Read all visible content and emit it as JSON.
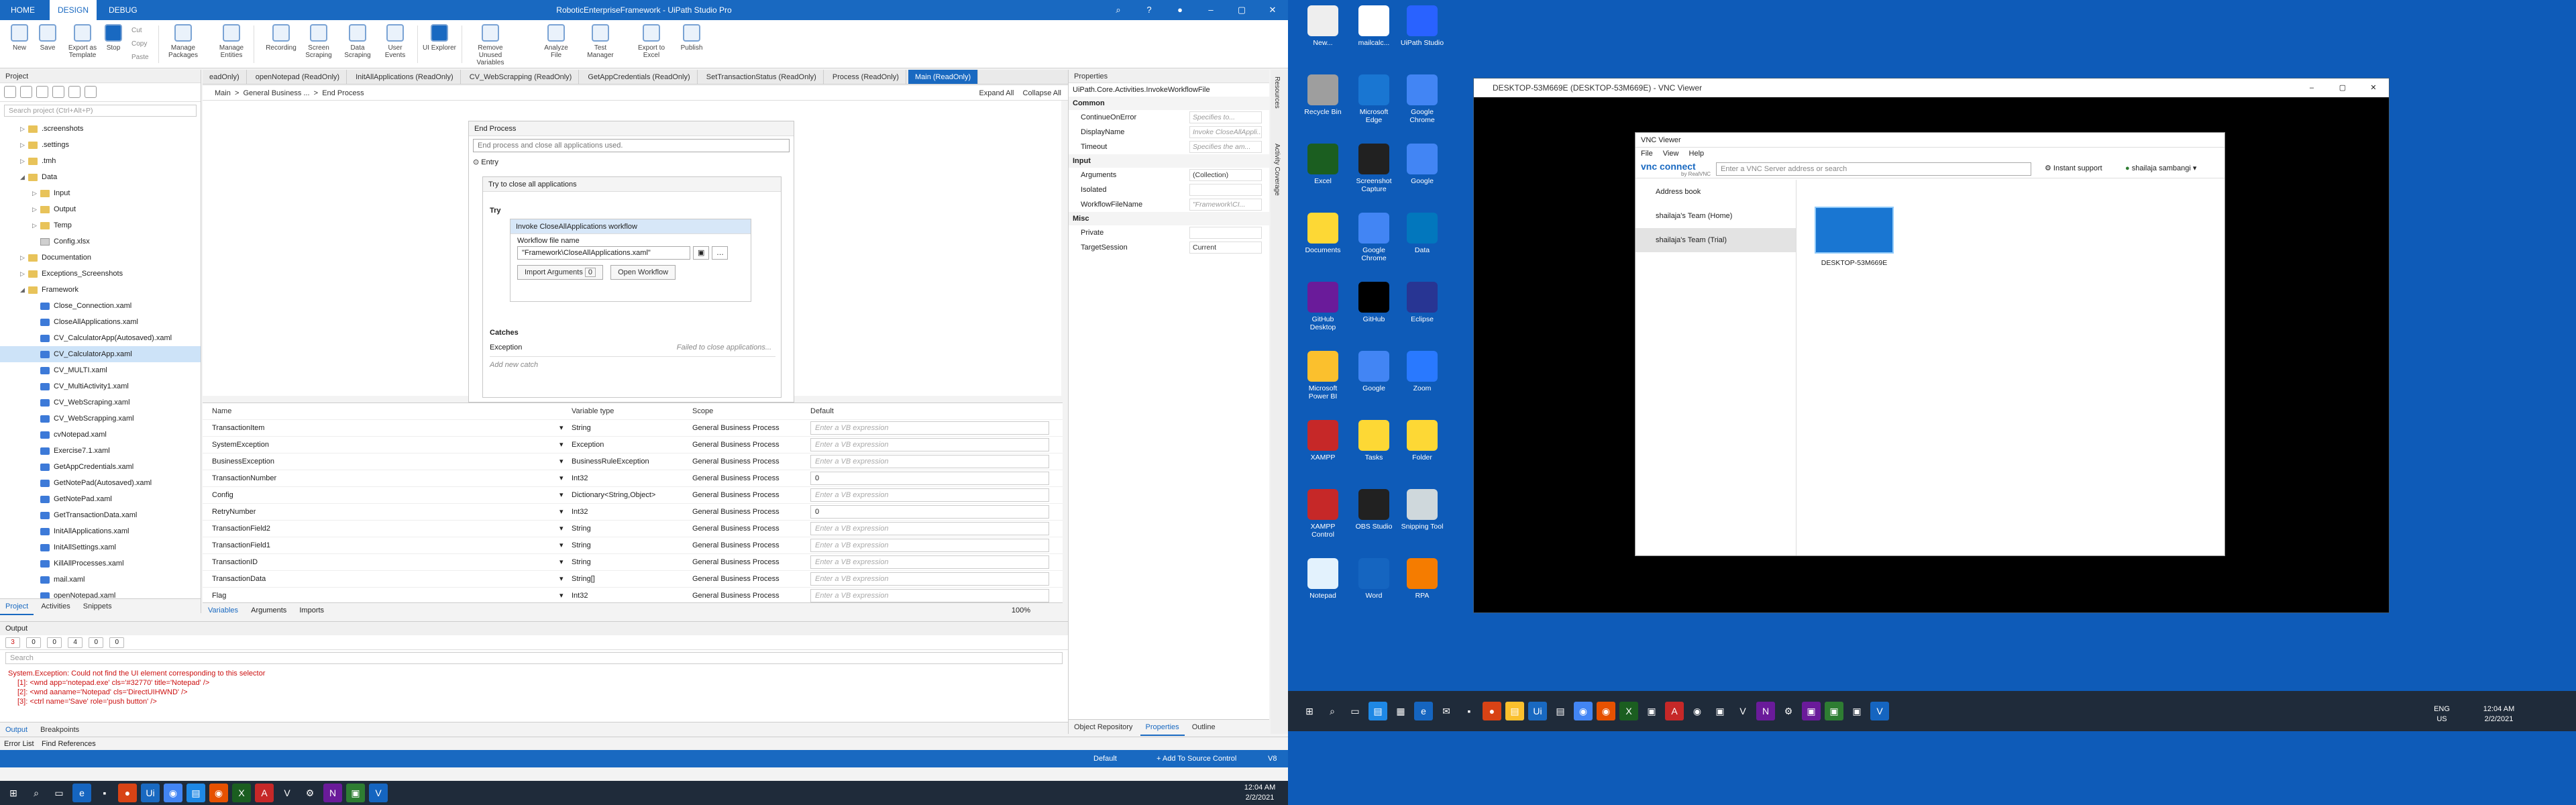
{
  "uipath": {
    "window_title": "RoboticEnterpriseFramework - UiPath Studio Pro",
    "ribbon_tabs": [
      "HOME",
      "DESIGN",
      "DEBUG"
    ],
    "ribbon_buttons": [
      {
        "label": "New"
      },
      {
        "label": "Save"
      },
      {
        "label": "Export as Template"
      },
      {
        "label": "Stop"
      },
      {
        "label": "Manage Packages"
      },
      {
        "label": "Manage Entities"
      },
      {
        "label": "Recording"
      },
      {
        "label": "Screen Scraping"
      },
      {
        "label": "Data Scraping"
      },
      {
        "label": "User Events"
      },
      {
        "label": "UI Explorer"
      },
      {
        "label": "Remove Unused Variables"
      },
      {
        "label": "Analyze File"
      },
      {
        "label": "Test Manager"
      },
      {
        "label": "Export to Excel"
      },
      {
        "label": "Publish"
      }
    ],
    "ribbon_small": [
      "Cut",
      "Copy",
      "Paste"
    ],
    "project_panel": {
      "title": "Project",
      "search_placeholder": "Search project (Ctrl+Alt+P)",
      "tree": [
        {
          "label": ".screenshots",
          "type": "folder",
          "level": 1,
          "arrow": "▷"
        },
        {
          "label": ".settings",
          "type": "folder",
          "level": 1,
          "arrow": "▷"
        },
        {
          "label": ".tmh",
          "type": "folder",
          "level": 1,
          "arrow": "▷"
        },
        {
          "label": "Data",
          "type": "folder",
          "level": 1,
          "arrow": "◢"
        },
        {
          "label": "Input",
          "type": "folder",
          "level": 2,
          "arrow": "▷"
        },
        {
          "label": "Output",
          "type": "folder",
          "level": 2,
          "arrow": "▷"
        },
        {
          "label": "Temp",
          "type": "folder",
          "level": 2,
          "arrow": "▷"
        },
        {
          "label": "Config.xlsx",
          "type": "file",
          "level": 2,
          "arrow": ""
        },
        {
          "label": "Documentation",
          "type": "folder",
          "level": 1,
          "arrow": "▷"
        },
        {
          "label": "Exceptions_Screenshots",
          "type": "folder",
          "level": 1,
          "arrow": "▷"
        },
        {
          "label": "Framework",
          "type": "folder",
          "level": 1,
          "arrow": "◢"
        },
        {
          "label": "Close_Connection.xaml",
          "type": "xaml",
          "level": 2,
          "arrow": ""
        },
        {
          "label": "CloseAllApplications.xaml",
          "type": "xaml",
          "level": 2,
          "arrow": ""
        },
        {
          "label": "CV_CalculatorApp(Autosaved).xaml",
          "type": "xaml",
          "level": 2,
          "arrow": ""
        },
        {
          "label": "CV_CalculatorApp.xaml",
          "type": "xaml",
          "level": 2,
          "arrow": "",
          "selected": true
        },
        {
          "label": "CV_MULTI.xaml",
          "type": "xaml",
          "level": 2,
          "arrow": ""
        },
        {
          "label": "CV_MultiActivity1.xaml",
          "type": "xaml",
          "level": 2,
          "arrow": ""
        },
        {
          "label": "CV_WebScraping.xaml",
          "type": "xaml",
          "level": 2,
          "arrow": ""
        },
        {
          "label": "CV_WebScrapping.xaml",
          "type": "xaml",
          "level": 2,
          "arrow": ""
        },
        {
          "label": "cvNotepad.xaml",
          "type": "xaml",
          "level": 2,
          "arrow": ""
        },
        {
          "label": "Exercise7.1.xaml",
          "type": "xaml",
          "level": 2,
          "arrow": ""
        },
        {
          "label": "GetAppCredentials.xaml",
          "type": "xaml",
          "level": 2,
          "arrow": ""
        },
        {
          "label": "GetNotePad(Autosaved).xaml",
          "type": "xaml",
          "level": 2,
          "arrow": ""
        },
        {
          "label": "GetNotePad.xaml",
          "type": "xaml",
          "level": 2,
          "arrow": ""
        },
        {
          "label": "GetTransactionData.xaml",
          "type": "xaml",
          "level": 2,
          "arrow": ""
        },
        {
          "label": "InitAllApplications.xaml",
          "type": "xaml",
          "level": 2,
          "arrow": ""
        },
        {
          "label": "InitAllSettings.xaml",
          "type": "xaml",
          "level": 2,
          "arrow": ""
        },
        {
          "label": "KillAllProcesses.xaml",
          "type": "xaml",
          "level": 2,
          "arrow": ""
        },
        {
          "label": "mail.xaml",
          "type": "xaml",
          "level": 2,
          "arrow": ""
        },
        {
          "label": "openNotepad.xaml",
          "type": "xaml",
          "level": 2,
          "arrow": ""
        }
      ],
      "bottom_tabs": [
        "Project",
        "Activities",
        "Snippets"
      ]
    },
    "doc_tabs": [
      "eadOnly)",
      "openNotepad (ReadOnly)",
      "InitAllApplications (ReadOnly)",
      "CV_WebScrapping (ReadOnly)",
      "GetAppCredentials (ReadOnly)",
      "SetTransactionStatus (ReadOnly)",
      "Process (ReadOnly)",
      "Main (ReadOnly)"
    ],
    "breadcrumb": {
      "items": [
        "Main",
        "General Business ...",
        "End Process"
      ],
      "expand_all": "Expand All",
      "collapse_all": "Collapse All"
    },
    "designer": {
      "end_process_title": "End Process",
      "end_process_desc": "End process and close all applications used.",
      "entry_label": "Entry",
      "try_close_title": "Try to close all applications",
      "try_label": "Try",
      "invoke_title": "Invoke CloseAllApplications workflow",
      "workflow_file_label": "Workflow file name",
      "workflow_file_value": "\"Framework\\CloseAllApplications.xaml\"",
      "import_args": "Import Arguments",
      "import_count": "0",
      "open_workflow": "Open Workflow",
      "catches_label": "Catches",
      "exception_label": "Exception",
      "exception_value": "Failed to close applications...",
      "add_catch": "Add new catch"
    },
    "variables": {
      "headers": [
        "Name",
        "Variable type",
        "Scope",
        "Default"
      ],
      "rows": [
        {
          "name": "TransactionItem",
          "type": "String",
          "scope": "General Business Process",
          "default": "Enter a VB expression"
        },
        {
          "name": "SystemException",
          "type": "Exception",
          "scope": "General Business Process",
          "default": "Enter a VB expression"
        },
        {
          "name": "BusinessException",
          "type": "BusinessRuleException",
          "scope": "General Business Process",
          "default": "Enter a VB expression"
        },
        {
          "name": "TransactionNumber",
          "type": "Int32",
          "scope": "General Business Process",
          "default": "0"
        },
        {
          "name": "Config",
          "type": "Dictionary<String,Object>",
          "scope": "General Business Process",
          "default": "Enter a VB expression"
        },
        {
          "name": "RetryNumber",
          "type": "Int32",
          "scope": "General Business Process",
          "default": "0"
        },
        {
          "name": "TransactionField2",
          "type": "String",
          "scope": "General Business Process",
          "default": "Enter a VB expression"
        },
        {
          "name": "TransactionField1",
          "type": "String",
          "scope": "General Business Process",
          "default": "Enter a VB expression"
        },
        {
          "name": "TransactionID",
          "type": "String",
          "scope": "General Business Process",
          "default": "Enter a VB expression"
        },
        {
          "name": "TransactionData",
          "type": "String[]",
          "scope": "General Business Process",
          "default": "Enter a VB expression"
        },
        {
          "name": "Flag",
          "type": "Int32",
          "scope": "General Business Process",
          "default": "Enter a VB expression"
        }
      ],
      "bottom_tabs": [
        "Variables",
        "Arguments",
        "Imports"
      ],
      "zoom": "100%"
    },
    "properties": {
      "title": "Properties",
      "activity_name": "UiPath.Core.Activities.InvokeWorkflowFile",
      "sections": [
        {
          "name": "Common",
          "rows": [
            {
              "label": "ContinueOnError",
              "value": "Specifies to..."
            },
            {
              "label": "DisplayName",
              "value": "Invoke CloseAllAppli..."
            },
            {
              "label": "Timeout",
              "value": "Specifies the am..."
            }
          ]
        },
        {
          "name": "Input",
          "rows": [
            {
              "label": "Arguments",
              "value": "(Collection)"
            },
            {
              "label": "Isolated",
              "value": ""
            },
            {
              "label": "WorkflowFileName",
              "value": "\"Framework\\CI..."
            }
          ]
        },
        {
          "name": "Misc",
          "rows": [
            {
              "label": "Private",
              "value": ""
            },
            {
              "label": "TargetSession",
              "value": "Current"
            }
          ]
        }
      ],
      "bottom_tabs": [
        "Object Repository",
        "Properties",
        "Outline"
      ]
    },
    "side_tabs": [
      "Resources",
      "Activity Coverage"
    ],
    "output": {
      "title": "Output",
      "filter_counts": [
        "3",
        "0",
        "0",
        "4",
        "0",
        "0"
      ],
      "search_placeholder": "Search",
      "lines": [
        "System.Exception: Could not find the UI element corresponding to this selector",
        "[1]: <wnd app='notepad.exe' cls='#32770' title='Notepad' />",
        "[2]: <wnd aaname='Notepad' cls='DirectUIHWND' />",
        "[3]: <ctrl name='Save' role='push button' />"
      ],
      "bottom_tabs": [
        "Output",
        "Breakpoints"
      ],
      "bottom_tabs2": [
        "Error List",
        "Find References"
      ]
    },
    "status": {
      "default": "Default",
      "source_control": "+ Add To Source Control",
      "version": "V8"
    }
  },
  "taskbar_left": {
    "time": "12:04 AM",
    "date": "2/2/2021"
  },
  "taskbar_right": {
    "lang": "ENG",
    "region": "US",
    "time": "12:04 AM",
    "date": "2/2/2021"
  },
  "desktop_icons": [
    {
      "label": "New..."
    },
    {
      "label": "mailcalc..."
    },
    {
      "label": "UiPath Studio"
    },
    {
      "label": "Recycle Bin"
    },
    {
      "label": "Microsoft Edge"
    },
    {
      "label": "Google Chrome"
    },
    {
      "label": "Excel"
    },
    {
      "label": "Screenshot Capture"
    },
    {
      "label": "Google"
    },
    {
      "label": "Documents"
    },
    {
      "label": "Google Chrome"
    },
    {
      "label": "Data"
    },
    {
      "label": "GitHub Desktop"
    },
    {
      "label": "GitHub"
    },
    {
      "label": "Eclipse"
    },
    {
      "label": "Microsoft Power BI"
    },
    {
      "label": "Google"
    },
    {
      "label": "Zoom"
    },
    {
      "label": "XAMPP"
    },
    {
      "label": "Tasks"
    },
    {
      "label": "Folder"
    },
    {
      "label": "XAMPP Control"
    },
    {
      "label": "OBS Studio"
    },
    {
      "label": "Snipping Tool"
    },
    {
      "label": "Notepad"
    },
    {
      "label": "Word"
    },
    {
      "label": "RPA"
    }
  ],
  "vnc": {
    "outer_title": "DESKTOP-53M669E (DESKTOP-53M669E) - VNC Viewer",
    "inner_title": "VNC Viewer",
    "menu": [
      "File",
      "View",
      "Help"
    ],
    "brand": "vnc connect",
    "brand_sub": "by RealVNC",
    "search_placeholder": "Enter a VNC Server address or search",
    "instant_support": "Instant support",
    "user": "shailaja sambangi",
    "sidebar": [
      "Address book",
      "shailaja's Team (Home)",
      "shailaja's Team (Trial)"
    ],
    "computer_label": "DESKTOP-53M669E"
  }
}
